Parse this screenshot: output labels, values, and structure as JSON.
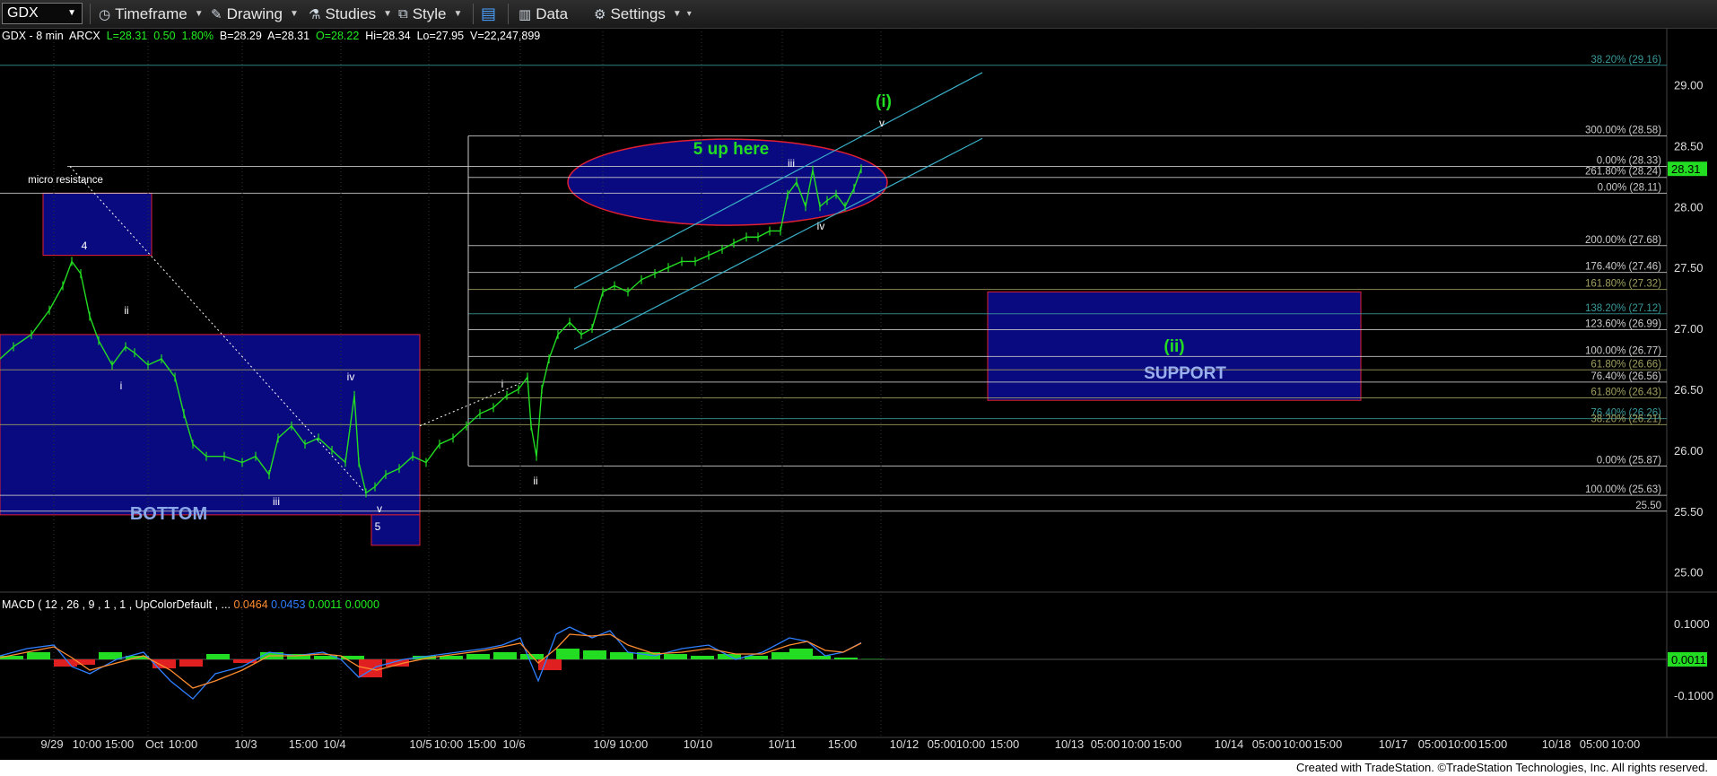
{
  "toolbar": {
    "symbol": "GDX",
    "timeframe": "Timeframe",
    "drawing": "Drawing",
    "studies": "Studies",
    "style": "Style",
    "data": "Data",
    "settings": "Settings"
  },
  "info": {
    "symbol_desc": "GDX - 8 min",
    "exchange": "ARCX",
    "last": "L=28.31",
    "change": "0.50",
    "change_pct": "1.80%",
    "bid": "B=28.29",
    "ask": "A=28.31",
    "open": "O=28.22",
    "high": "Hi=28.34",
    "low": "Lo=27.95",
    "volume": "V=22,247,899"
  },
  "macd": {
    "label": "MACD ( 12 , 26 , 9 , 1 , 1 , UpColorDefault , ...",
    "v1": "0.0464",
    "v2": "0.0453",
    "v3": "0.0011",
    "v4": "0.0000",
    "axis_labels": [
      "0.1000",
      "-0.1000"
    ],
    "current": "0.0011"
  },
  "credit": "Created with TradeStation. ©TradeStation Technologies, Inc. All rights reserved.",
  "colors": {
    "price": "#22dd22",
    "box_fill": "#0a0a80",
    "box_border": "#e02030",
    "channel": "#3ab0c8",
    "fib_teal": "#3a8a8a",
    "fib_olive": "#a0a060",
    "macd_hist_up": "#22dd22",
    "macd_hist_down": "#e02020",
    "macd_line": "#2f7fff",
    "signal_line": "#ff8c30"
  },
  "chart_data": {
    "type": "line",
    "title": "GDX - 8 min",
    "ylim": [
      24.85,
      29.45
    ],
    "y_ticks": [
      25.0,
      25.5,
      26.0,
      26.5,
      27.0,
      27.5,
      28.0,
      28.5,
      29.0
    ],
    "x_ticks": [
      "9/29",
      "10:00",
      "15:00",
      "Oct",
      "10:00",
      "10/3",
      "15:00",
      "10/4",
      "10/5",
      "10:00",
      "15:00",
      "10/6",
      "10/9",
      "10:00",
      "10/10",
      "10/11",
      "15:00",
      "10/12",
      "05:00",
      "10:00",
      "15:00",
      "10/13",
      "05:00",
      "10:00",
      "15:00",
      "10/14",
      "05:00",
      "10:00",
      "15:00",
      "10/17",
      "05:00",
      "10:00",
      "15:00",
      "10/18",
      "05:00",
      "10:00"
    ],
    "price_series": [
      [
        0,
        26.75
      ],
      [
        15,
        26.85
      ],
      [
        35,
        26.95
      ],
      [
        55,
        27.15
      ],
      [
        70,
        27.35
      ],
      [
        80,
        27.55
      ],
      [
        90,
        27.45
      ],
      [
        100,
        27.1
      ],
      [
        110,
        26.9
      ],
      [
        125,
        26.7
      ],
      [
        140,
        26.85
      ],
      [
        150,
        26.8
      ],
      [
        165,
        26.7
      ],
      [
        180,
        26.75
      ],
      [
        195,
        26.6
      ],
      [
        205,
        26.3
      ],
      [
        215,
        26.05
      ],
      [
        230,
        25.95
      ],
      [
        250,
        25.95
      ],
      [
        270,
        25.9
      ],
      [
        285,
        25.95
      ],
      [
        300,
        25.8
      ],
      [
        310,
        26.1
      ],
      [
        325,
        26.2
      ],
      [
        340,
        26.05
      ],
      [
        355,
        26.1
      ],
      [
        370,
        26.0
      ],
      [
        385,
        25.9
      ],
      [
        395,
        26.45
      ],
      [
        400,
        25.9
      ],
      [
        408,
        25.65
      ],
      [
        418,
        25.7
      ],
      [
        430,
        25.8
      ],
      [
        445,
        25.85
      ],
      [
        460,
        25.95
      ],
      [
        475,
        25.9
      ],
      [
        490,
        26.05
      ],
      [
        505,
        26.1
      ],
      [
        520,
        26.2
      ],
      [
        535,
        26.3
      ],
      [
        550,
        26.35
      ],
      [
        565,
        26.45
      ],
      [
        578,
        26.5
      ],
      [
        588,
        26.6
      ],
      [
        592,
        26.2
      ],
      [
        598,
        25.95
      ],
      [
        604,
        26.5
      ],
      [
        612,
        26.75
      ],
      [
        622,
        26.95
      ],
      [
        635,
        27.05
      ],
      [
        648,
        26.95
      ],
      [
        660,
        27.0
      ],
      [
        672,
        27.3
      ],
      [
        685,
        27.35
      ],
      [
        700,
        27.3
      ],
      [
        715,
        27.4
      ],
      [
        730,
        27.45
      ],
      [
        745,
        27.5
      ],
      [
        760,
        27.55
      ],
      [
        775,
        27.55
      ],
      [
        790,
        27.6
      ],
      [
        805,
        27.65
      ],
      [
        818,
        27.7
      ],
      [
        832,
        27.75
      ],
      [
        845,
        27.75
      ],
      [
        858,
        27.8
      ],
      [
        870,
        27.8
      ],
      [
        878,
        28.1
      ],
      [
        888,
        28.2
      ],
      [
        898,
        28.0
      ],
      [
        906,
        28.3
      ],
      [
        914,
        28.0
      ],
      [
        922,
        28.05
      ],
      [
        932,
        28.1
      ],
      [
        942,
        28.0
      ],
      [
        952,
        28.15
      ],
      [
        960,
        28.31
      ]
    ],
    "annotations": [
      {
        "text": "micro resistance"
      },
      {
        "text": "4"
      },
      {
        "text": "ii"
      },
      {
        "text": "i"
      },
      {
        "text": "iii"
      },
      {
        "text": "iv"
      },
      {
        "text": "v"
      },
      {
        "text": "5"
      },
      {
        "text": "BOTTOM"
      },
      {
        "text": "i"
      },
      {
        "text": "ii"
      },
      {
        "text": "iii"
      },
      {
        "text": "iv"
      },
      {
        "text": "v"
      },
      {
        "text": "(i)"
      },
      {
        "text": "5 up here"
      },
      {
        "text": "(ii)"
      },
      {
        "text": "SUPPORT"
      }
    ],
    "fib_levels": [
      {
        "label": "38.20% (29.16)",
        "value": 29.16,
        "color": "#3a9a9a"
      },
      {
        "label": "300.00% (28.58)",
        "value": 28.58,
        "color": "#cccccc"
      },
      {
        "label": "0.00% (28.33)",
        "value": 28.33,
        "color": "#cccccc"
      },
      {
        "label": "261.80% (28.24)",
        "value": 28.24,
        "color": "#cccccc"
      },
      {
        "label": "0.00% (28.11)",
        "value": 28.11,
        "color": "#cccccc"
      },
      {
        "label": "200.00% (27.68)",
        "value": 27.68,
        "color": "#cccccc"
      },
      {
        "label": "176.40% (27.46)",
        "value": 27.46,
        "color": "#cccccc"
      },
      {
        "label": "161.80% (27.32)",
        "value": 27.32,
        "color": "#a0a060"
      },
      {
        "label": "138.20% (27.12)",
        "value": 27.12,
        "color": "#3a9a9a"
      },
      {
        "label": "123.60% (26.99)",
        "value": 26.99,
        "color": "#cccccc"
      },
      {
        "label": "100.00% (26.77)",
        "value": 26.77,
        "color": "#cccccc"
      },
      {
        "label": "61.80% (26.66)",
        "value": 26.66,
        "color": "#a0a060"
      },
      {
        "label": "76.40% (26.56)",
        "value": 26.56,
        "color": "#cccccc"
      },
      {
        "label": "61.80% (26.43)",
        "value": 26.43,
        "color": "#a0a060"
      },
      {
        "label": "76.40% (26.26)",
        "value": 26.26,
        "color": "#3a9a9a"
      },
      {
        "label": "38.20% (26.21)",
        "value": 26.21,
        "color": "#a0a060"
      },
      {
        "label": "0.00% (25.87)",
        "value": 25.87,
        "color": "#cccccc"
      },
      {
        "label": "100.00% (25.63)",
        "value": 25.63,
        "color": "#cccccc"
      },
      {
        "label": "25.50",
        "value": 25.5,
        "color": "#cccccc"
      }
    ],
    "last_price": "28.31",
    "macd_histogram": [
      [
        0,
        0.01
      ],
      [
        30,
        0.02
      ],
      [
        60,
        -0.02
      ],
      [
        80,
        -0.015
      ],
      [
        110,
        0.02
      ],
      [
        140,
        0.01
      ],
      [
        170,
        -0.025
      ],
      [
        200,
        -0.02
      ],
      [
        230,
        0.015
      ],
      [
        260,
        -0.01
      ],
      [
        290,
        0.02
      ],
      [
        320,
        0.015
      ],
      [
        350,
        0.01
      ],
      [
        380,
        0.01
      ],
      [
        400,
        -0.05
      ],
      [
        430,
        -0.02
      ],
      [
        460,
        0.01
      ],
      [
        490,
        0.01
      ],
      [
        520,
        0.015
      ],
      [
        550,
        0.02
      ],
      [
        580,
        0.015
      ],
      [
        600,
        -0.03
      ],
      [
        620,
        0.03
      ],
      [
        650,
        0.025
      ],
      [
        680,
        0.02
      ],
      [
        710,
        0.02
      ],
      [
        740,
        0.015
      ],
      [
        770,
        0.01
      ],
      [
        800,
        0.015
      ],
      [
        830,
        0.01
      ],
      [
        860,
        0.02
      ],
      [
        880,
        0.03
      ],
      [
        900,
        0.01
      ],
      [
        930,
        0.005
      ],
      [
        960,
        0.0011
      ]
    ],
    "macd_line": [
      [
        0,
        0.01
      ],
      [
        30,
        0.03
      ],
      [
        60,
        0.04
      ],
      [
        80,
        -0.02
      ],
      [
        100,
        -0.04
      ],
      [
        130,
        0.0
      ],
      [
        160,
        0.02
      ],
      [
        190,
        -0.06
      ],
      [
        215,
        -0.11
      ],
      [
        240,
        -0.04
      ],
      [
        270,
        -0.02
      ],
      [
        300,
        0.02
      ],
      [
        330,
        0.01
      ],
      [
        360,
        0.02
      ],
      [
        380,
        0.0
      ],
      [
        400,
        -0.05
      ],
      [
        420,
        -0.02
      ],
      [
        450,
        0.0
      ],
      [
        480,
        0.01
      ],
      [
        510,
        0.02
      ],
      [
        540,
        0.03
      ],
      [
        560,
        0.04
      ],
      [
        580,
        0.06
      ],
      [
        600,
        -0.06
      ],
      [
        620,
        0.07
      ],
      [
        635,
        0.09
      ],
      [
        660,
        0.06
      ],
      [
        680,
        0.08
      ],
      [
        700,
        0.02
      ],
      [
        730,
        0.01
      ],
      [
        760,
        0.03
      ],
      [
        790,
        0.04
      ],
      [
        820,
        0.0
      ],
      [
        850,
        0.02
      ],
      [
        880,
        0.06
      ],
      [
        900,
        0.05
      ],
      [
        920,
        0.01
      ],
      [
        940,
        0.02
      ],
      [
        960,
        0.0464
      ]
    ],
    "signal_line": [
      [
        0,
        0.005
      ],
      [
        30,
        0.02
      ],
      [
        60,
        0.035
      ],
      [
        80,
        0.005
      ],
      [
        100,
        -0.03
      ],
      [
        130,
        -0.01
      ],
      [
        160,
        0.01
      ],
      [
        190,
        -0.03
      ],
      [
        215,
        -0.08
      ],
      [
        240,
        -0.06
      ],
      [
        270,
        -0.03
      ],
      [
        300,
        0.01
      ],
      [
        330,
        0.01
      ],
      [
        360,
        0.015
      ],
      [
        380,
        0.01
      ],
      [
        400,
        -0.02
      ],
      [
        420,
        -0.03
      ],
      [
        450,
        -0.01
      ],
      [
        480,
        0.005
      ],
      [
        510,
        0.015
      ],
      [
        540,
        0.025
      ],
      [
        560,
        0.035
      ],
      [
        580,
        0.045
      ],
      [
        600,
        -0.01
      ],
      [
        620,
        0.03
      ],
      [
        635,
        0.07
      ],
      [
        660,
        0.065
      ],
      [
        680,
        0.07
      ],
      [
        700,
        0.04
      ],
      [
        730,
        0.015
      ],
      [
        760,
        0.02
      ],
      [
        790,
        0.03
      ],
      [
        820,
        0.015
      ],
      [
        850,
        0.015
      ],
      [
        880,
        0.04
      ],
      [
        900,
        0.05
      ],
      [
        920,
        0.025
      ],
      [
        940,
        0.02
      ],
      [
        960,
        0.0453
      ]
    ]
  }
}
